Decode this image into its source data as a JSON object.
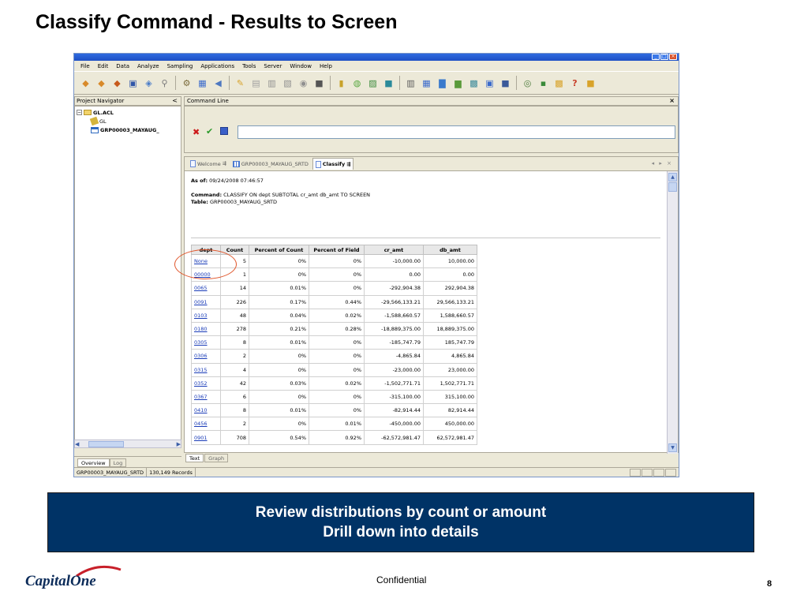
{
  "slide": {
    "title": "Classify Command - Results to Screen",
    "callout_line1": "Review distributions by count or amount",
    "callout_line2": "Drill down into details",
    "footer_label": "Confidential",
    "page_number": "8",
    "logo_text": "CapitalOne"
  },
  "app": {
    "menu": [
      "File",
      "Edit",
      "Data",
      "Analyze",
      "Sampling",
      "Applications",
      "Tools",
      "Server",
      "Window",
      "Help"
    ],
    "toolbar_icons": [
      {
        "icon": "open-project-icon",
        "color": "#d88a2a"
      },
      {
        "icon": "new-project-icon",
        "color": "#d88a2a"
      },
      {
        "icon": "open-table-icon",
        "color": "#c75a1d"
      },
      {
        "icon": "save-icon",
        "color": "#3056a8"
      },
      {
        "icon": "print-icon",
        "color": "#4a7cc8"
      },
      {
        "icon": "find-icon",
        "color": "#7a7a7a"
      },
      {
        "icon": "sep"
      },
      {
        "icon": "filter-icon",
        "color": "#7a6a3a"
      },
      {
        "icon": "table-layout-icon",
        "color": "#3a6acc"
      },
      {
        "icon": "back-icon",
        "color": "#4e78c0"
      },
      {
        "icon": "sep"
      },
      {
        "icon": "edit-icon",
        "color": "#d8a32a"
      },
      {
        "icon": "notes-icon",
        "color": "#a0a0a0"
      },
      {
        "icon": "view-icon",
        "color": "#909090"
      },
      {
        "icon": "report-icon",
        "color": "#909090"
      },
      {
        "icon": "history-icon",
        "color": "#909090"
      },
      {
        "icon": "log-icon",
        "color": "#555555"
      },
      {
        "icon": "sep"
      },
      {
        "icon": "flag-icon",
        "color": "#c8a22a"
      },
      {
        "icon": "stats-icon",
        "color": "#58a840"
      },
      {
        "icon": "profile-icon",
        "color": "#3a8a3a"
      },
      {
        "icon": "sample-icon",
        "color": "#2a8a9a"
      },
      {
        "icon": "sep"
      },
      {
        "icon": "classify-icon",
        "color": "#5a5a5a"
      },
      {
        "icon": "summarize-icon",
        "color": "#3a6acc"
      },
      {
        "icon": "crosstab-icon",
        "color": "#3a7acc"
      },
      {
        "icon": "histogram-icon",
        "color": "#5a9a3a"
      },
      {
        "icon": "age-icon",
        "color": "#3a8a9a"
      },
      {
        "icon": "duplicates-icon",
        "color": "#3a6acc"
      },
      {
        "icon": "gaps-icon",
        "color": "#3a5a9a"
      },
      {
        "icon": "sep"
      },
      {
        "icon": "script-icon",
        "color": "#4a7a3a"
      },
      {
        "icon": "workspace-icon",
        "color": "#3a8a3a"
      },
      {
        "icon": "sort-icon",
        "color": "#d8a32a"
      },
      {
        "icon": "color-icon",
        "color": "#c8402a"
      },
      {
        "icon": "help-icon",
        "color": "#d8a32a"
      }
    ],
    "navigator": {
      "title": "Project Navigator",
      "collapse_glyph": "<",
      "items": [
        {
          "label": "GL.ACL",
          "icon": "folder"
        },
        {
          "label": "GL",
          "icon": "gl"
        },
        {
          "label": "GRP00003_MAYAUG_",
          "icon": "table"
        }
      ],
      "tabs": [
        "Overview",
        "Log"
      ]
    },
    "command_line": {
      "title": "Command Line",
      "close_glyph": "×",
      "input_value": ""
    },
    "doc_tabs": [
      "Welcome",
      "GRP00003_MAYAUG_SRTD",
      "Classify"
    ],
    "result": {
      "as_of_label": "As of:",
      "as_of_value": "09/24/2008 07:46:57",
      "command_label": "Command:",
      "command_value": "CLASSIFY ON dept SUBTOTAL cr_amt db_amt TO SCREEN",
      "table_label": "Table:",
      "table_value": "GRP00003_MAYAUG_SRTD",
      "headers": [
        "dept",
        "Count",
        "Percent of Count",
        "Percent of Field",
        "cr_amt",
        "db_amt"
      ],
      "rows": [
        [
          "None",
          "5",
          "0%",
          "0%",
          "-10,000.00",
          "10,000.00"
        ],
        [
          "00000",
          "1",
          "0%",
          "0%",
          "0.00",
          "0.00"
        ],
        [
          "0065",
          "14",
          "0.01%",
          "0%",
          "-292,904.38",
          "292,904.38"
        ],
        [
          "0091",
          "226",
          "0.17%",
          "0.44%",
          "-29,566,133.21",
          "29,566,133.21"
        ],
        [
          "0103",
          "48",
          "0.04%",
          "0.02%",
          "-1,588,660.57",
          "1,588,660.57"
        ],
        [
          "0180",
          "278",
          "0.21%",
          "0.28%",
          "-18,889,375.00",
          "18,889,375.00"
        ],
        [
          "0305",
          "8",
          "0.01%",
          "0%",
          "-185,747.79",
          "185,747.79"
        ],
        [
          "0306",
          "2",
          "0%",
          "0%",
          "-4,865.84",
          "4,865.84"
        ],
        [
          "0315",
          "4",
          "0%",
          "0%",
          "-23,000.00",
          "23,000.00"
        ],
        [
          "0352",
          "42",
          "0.03%",
          "0.02%",
          "-1,502,771.71",
          "1,502,771.71"
        ],
        [
          "0367",
          "6",
          "0%",
          "0%",
          "-315,100.00",
          "315,100.00"
        ],
        [
          "0410",
          "8",
          "0.01%",
          "0%",
          "-82,914.44",
          "82,914.44"
        ],
        [
          "0456",
          "2",
          "0%",
          "0.01%",
          "-450,000.00",
          "450,000.00"
        ],
        [
          "0901",
          "708",
          "0.54%",
          "0.92%",
          "-62,572,981.47",
          "62,572,981.47"
        ]
      ],
      "view_tabs": [
        "Text",
        "Graph"
      ]
    },
    "status": {
      "table_name": "GRP00003_MAYAUG_SRTD",
      "records": "130,149 Records"
    }
  }
}
